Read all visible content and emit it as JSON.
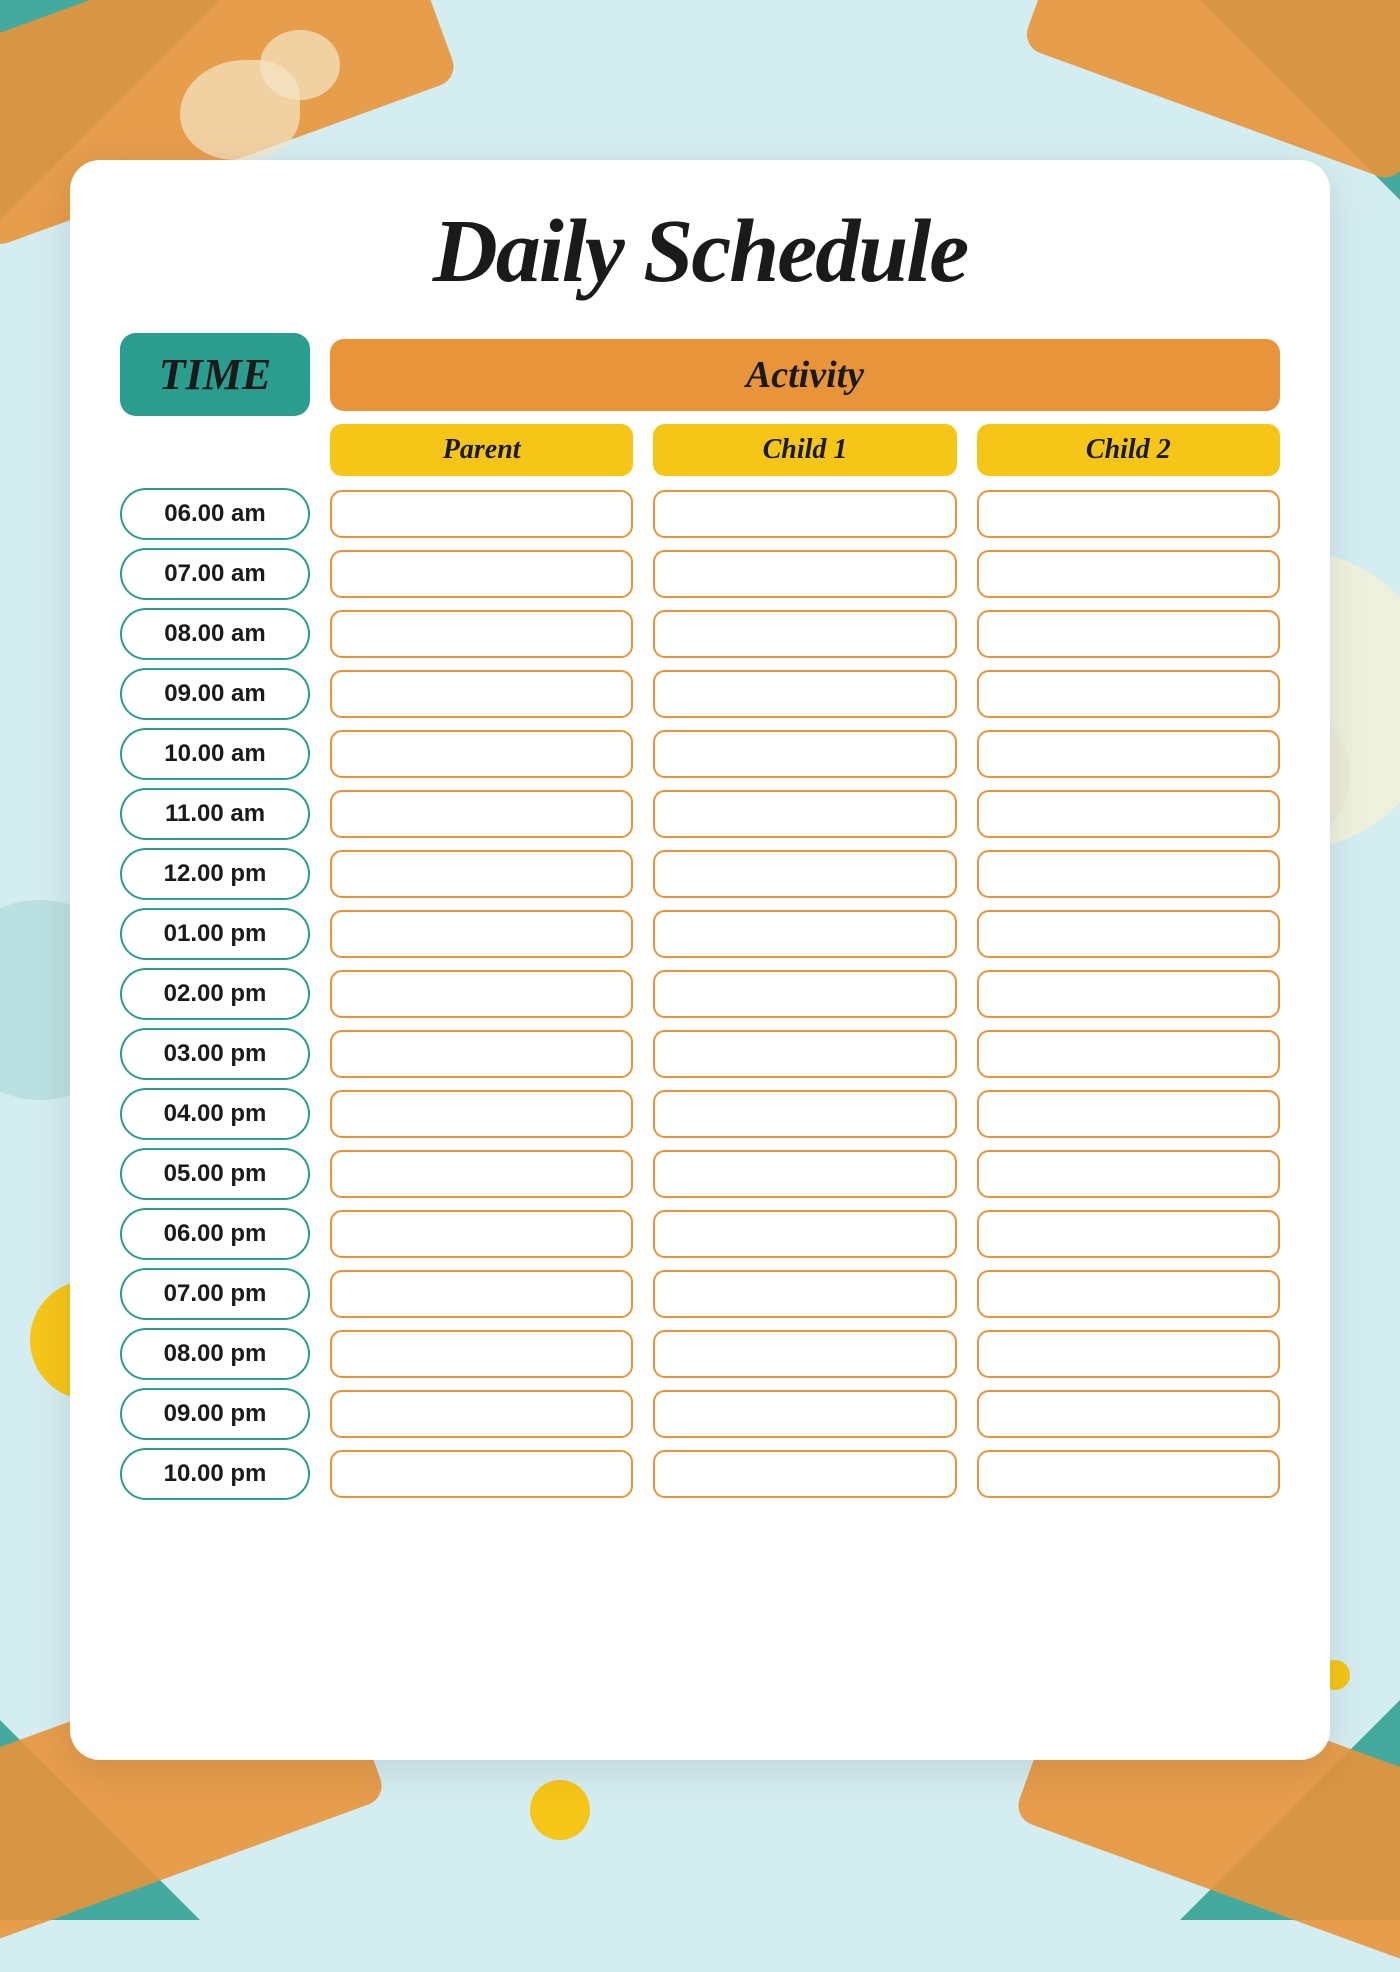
{
  "title": "Daily Schedule",
  "time_label": "TIME",
  "activity_label": "Activity",
  "sub_headers": {
    "parent": "Parent",
    "child1": "Child 1",
    "child2": "Child 2"
  },
  "time_slots": [
    "06.00 am",
    "07.00 am",
    "08.00 am",
    "09.00 am",
    "10.00 am",
    "11.00 am",
    "12.00 pm",
    "01.00 pm",
    "02.00 pm",
    "03.00 pm",
    "04.00 pm",
    "05.00 pm",
    "06.00 pm",
    "07.00 pm",
    "08.00 pm",
    "09.00 pm",
    "10.00 pm"
  ],
  "colors": {
    "teal": "#2a9d8f",
    "orange": "#e8943a",
    "yellow": "#f5c518",
    "bg": "#d4edf0",
    "white": "#ffffff"
  }
}
